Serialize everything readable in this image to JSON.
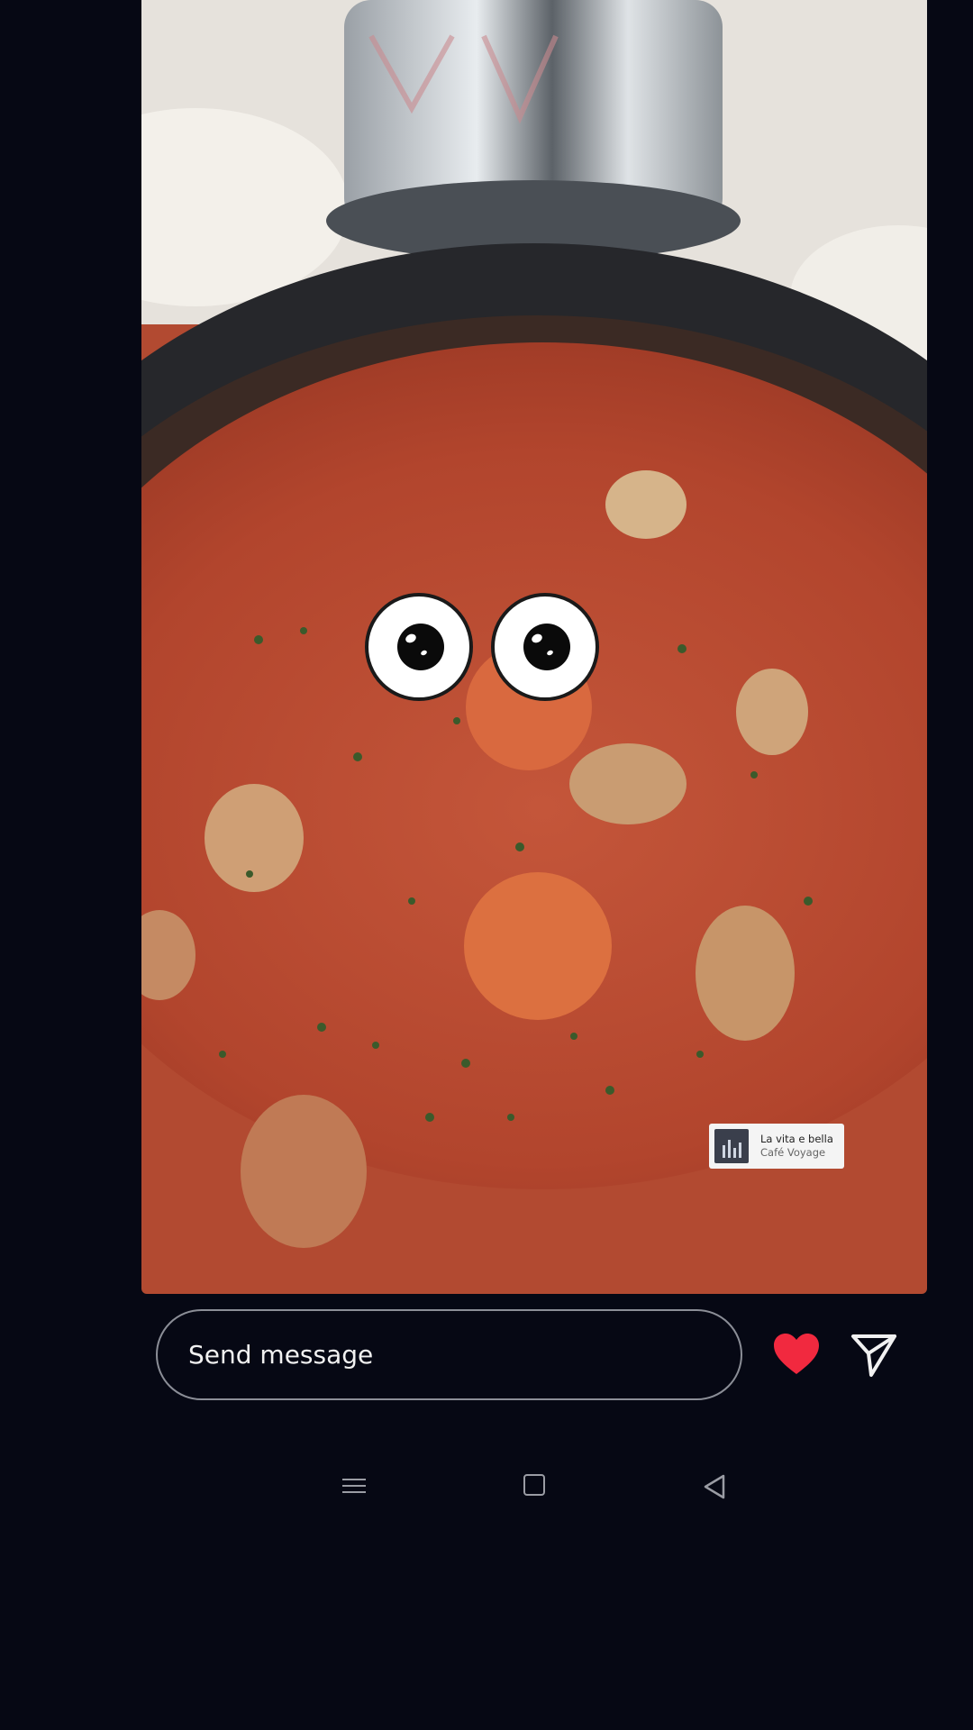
{
  "story": {
    "music_sticker": {
      "title": "La vita e bella",
      "artist": "Café Voyage"
    }
  },
  "reply_bar": {
    "message_placeholder": "Send message"
  },
  "icons": {
    "like": "heart-icon",
    "send": "paper-plane-icon",
    "nav_menu": "menu-icon",
    "nav_home": "home-icon",
    "nav_back": "back-icon"
  },
  "colors": {
    "background": "#060814",
    "heart": "#f1293f",
    "input_border": "#8b8e97",
    "text": "#f1f1f1"
  }
}
